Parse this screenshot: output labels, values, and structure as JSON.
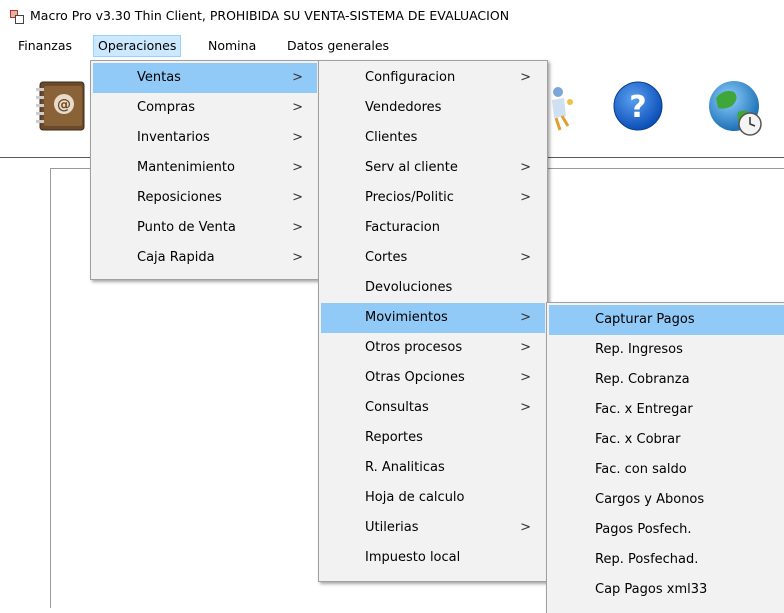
{
  "window": {
    "title": "Macro Pro v3.30 Thin Client, PROHIBIDA SU VENTA-SISTEMA DE EVALUACION"
  },
  "menubar": {
    "items": [
      {
        "label": "Finanzas"
      },
      {
        "label": "Operaciones"
      },
      {
        "label": "Nomina"
      },
      {
        "label": "Datos generales"
      }
    ]
  },
  "toolbar": {
    "tools": [
      {
        "icon": "address-book-icon"
      },
      {
        "icon": "wizard-icon"
      },
      {
        "icon": "help-icon",
        "glyph": "?"
      },
      {
        "icon": "globe-clock-icon"
      }
    ]
  },
  "menus": {
    "operaciones": [
      {
        "label": "Ventas",
        "submenu": true
      },
      {
        "label": "Compras",
        "submenu": true
      },
      {
        "label": "Inventarios",
        "submenu": true
      },
      {
        "label": "Mantenimiento",
        "submenu": true
      },
      {
        "label": "Reposiciones",
        "submenu": true
      },
      {
        "label": "Punto de Venta",
        "submenu": true
      },
      {
        "label": "Caja Rapida",
        "submenu": true
      }
    ],
    "ventas": [
      {
        "label": "Configuracion",
        "submenu": true
      },
      {
        "label": "Vendedores",
        "submenu": false
      },
      {
        "label": "Clientes",
        "submenu": false
      },
      {
        "label": "Serv al cliente",
        "submenu": true
      },
      {
        "label": "Precios/Politic",
        "submenu": true
      },
      {
        "label": "Facturacion",
        "submenu": false
      },
      {
        "label": "Cortes",
        "submenu": true
      },
      {
        "label": "Devoluciones",
        "submenu": false
      },
      {
        "label": "Movimientos",
        "submenu": true
      },
      {
        "label": "Otros procesos",
        "submenu": true
      },
      {
        "label": "Otras Opciones",
        "submenu": true
      },
      {
        "label": "Consultas",
        "submenu": true
      },
      {
        "label": "Reportes",
        "submenu": false
      },
      {
        "label": "R. Analiticas",
        "submenu": false
      },
      {
        "label": "Hoja de calculo",
        "submenu": false
      },
      {
        "label": "Utilerias",
        "submenu": true
      },
      {
        "label": "Impuesto local",
        "submenu": false
      }
    ],
    "movimientos": [
      {
        "label": "Capturar Pagos"
      },
      {
        "label": "Rep. Ingresos"
      },
      {
        "label": "Rep. Cobranza"
      },
      {
        "label": "Fac. x Entregar"
      },
      {
        "label": "Fac. x Cobrar"
      },
      {
        "label": "Fac. con saldo"
      },
      {
        "label": "Cargos y Abonos"
      },
      {
        "label": "Pagos Posfech."
      },
      {
        "label": "Rep. Posfechad."
      },
      {
        "label": "Cap Pagos xml33"
      }
    ]
  },
  "colors": {
    "highlight": "#91c9f7",
    "menubar_active": "#cce8ff",
    "menu_bg": "#f2f2f2"
  }
}
